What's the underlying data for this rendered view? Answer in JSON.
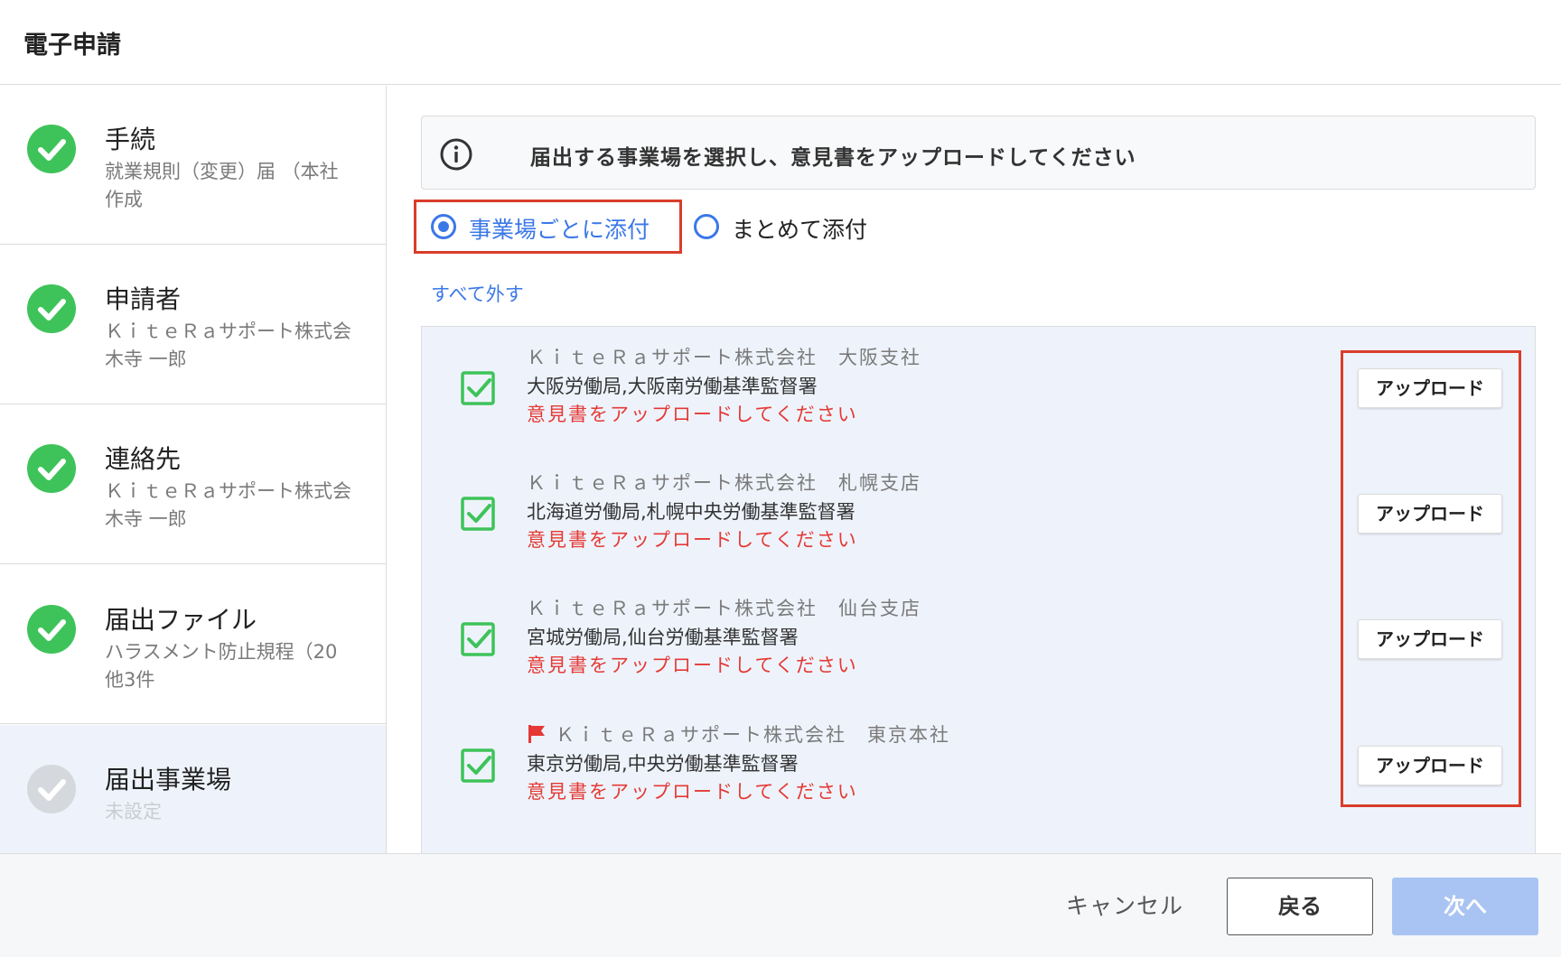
{
  "header": {
    "title": "電子申請"
  },
  "sidebar": {
    "steps": [
      {
        "label": "手続",
        "sub1": "就業規則（変更）届 （本社",
        "sub2": "作成",
        "status": "done"
      },
      {
        "label": "申請者",
        "sub1": "ＫｉｔｅＲａサポート株式会",
        "sub2": "木寺 一郎",
        "status": "done"
      },
      {
        "label": "連絡先",
        "sub1": "ＫｉｔｅＲａサポート株式会",
        "sub2": "木寺 一郎",
        "status": "done"
      },
      {
        "label": "届出ファイル",
        "sub1": "ハラスメント防止規程（20",
        "sub2": "他3件",
        "status": "done"
      },
      {
        "label": "届出事業場",
        "sub1": "未設定",
        "status": "pending"
      }
    ]
  },
  "main": {
    "banner_text": "届出する事業場を選択し、意見書をアップロードしてください",
    "radio_options": [
      {
        "label": "事業場ごとに添付",
        "selected": true
      },
      {
        "label": "まとめて添付",
        "selected": false
      }
    ],
    "deselect_all": "すべて外す",
    "offices": [
      {
        "name": "ＫｉｔｅＲａサポート株式会社　大阪支社",
        "bureau": "大阪労働局,大阪南労働基準監督署",
        "warning": "意見書をアップロードしてください",
        "upload_label": "アップロード",
        "checked": true,
        "flag": false
      },
      {
        "name": "ＫｉｔｅＲａサポート株式会社　札幌支店",
        "bureau": "北海道労働局,札幌中央労働基準監督署",
        "warning": "意見書をアップロードしてください",
        "upload_label": "アップロード",
        "checked": true,
        "flag": false
      },
      {
        "name": "ＫｉｔｅＲａサポート株式会社　仙台支店",
        "bureau": "宮城労働局,仙台労働基準監督署",
        "warning": "意見書をアップロードしてください",
        "upload_label": "アップロード",
        "checked": true,
        "flag": false
      },
      {
        "name": "ＫｉｔｅＲａサポート株式会社　東京本社",
        "bureau": "東京労働局,中央労働基準監督署",
        "warning": "意見書をアップロードしてください",
        "upload_label": "アップロード",
        "checked": true,
        "flag": true,
        "flag_icon": "flag-icon"
      }
    ]
  },
  "footer": {
    "cancel": "キャンセル",
    "back": "戻る",
    "next": "次へ"
  },
  "colors": {
    "accent": "#3b78e7",
    "success": "#3ec35a",
    "error": "#e53935",
    "highlight_frame": "#d93d2b",
    "next_disabled": "#a9c4f3"
  }
}
